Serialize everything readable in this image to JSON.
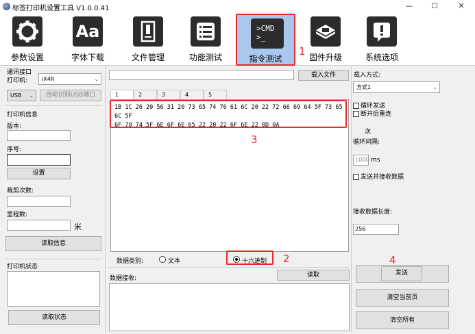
{
  "window": {
    "title": "标签打印机设置工具  V1.0.0.41",
    "minimize": "—",
    "maximize": "☐",
    "close": "✕"
  },
  "toolbar": {
    "items": [
      {
        "label": "参数设置",
        "icon": "gear-icon"
      },
      {
        "label": "字体下载",
        "icon_text": "Aa"
      },
      {
        "label": "文件管理",
        "icon": "file-icon"
      },
      {
        "label": "功能测试",
        "icon": "list-icon"
      },
      {
        "label": "指令测试",
        "icon_text": ">CMD\n>_"
      },
      {
        "label": "固件升级",
        "icon": "chip-icon"
      },
      {
        "label": "系统选项",
        "icon": "alert-icon"
      }
    ]
  },
  "annotations": {
    "n1": "1",
    "n2": "2",
    "n3": "3",
    "n4": "4"
  },
  "left": {
    "comm_label": "通讯接口",
    "printer_label": "打印机:",
    "printer_value": "iX4R",
    "port_value": "USB",
    "auto_button": "自动识别USB端口",
    "info_label": "打印机信息",
    "version_label": "版本:",
    "serial_label": "序号:",
    "set_button": "设置",
    "cut_label": "裁剪次数:",
    "mileage_label": "里程数:",
    "mileage_unit": "米",
    "read_info_button": "读取信息",
    "status_label": "打印机状态",
    "read_status_button": "读取状态"
  },
  "center": {
    "load_file_button": "载入文件",
    "tabs": [
      "1",
      "2",
      "3",
      "4",
      "5"
    ],
    "hex_lines": [
      "1B 1C 26 20 56 31 20 73 65 74 76 61 6C 20 22 72 66 69 64 5F 73 65 6C 5F",
      "6F 70 74 5F 6E 6F 6E 65 22 20 22 6F 6E 22 0D 0A"
    ],
    "data_type_label": "数据类别:",
    "radio_text": "文本",
    "radio_hex": "十六进制",
    "receive_label": "数据接收:",
    "read_button": "读取"
  },
  "right": {
    "mode_label": "载入方式:",
    "mode_value": "方式1",
    "loop_send": "循环发送",
    "reconnect": "断开后重连",
    "times_unit": "次",
    "interval_label": "循环间隔:",
    "interval_value": "1000",
    "interval_unit": "ms",
    "send_receive": "发送并接收数据",
    "recv_len_label": "接收数据长度:",
    "recv_len_value": "256",
    "send_button": "发送",
    "clear_page_button": "清空当前页",
    "clear_all_button": "清空所有"
  }
}
